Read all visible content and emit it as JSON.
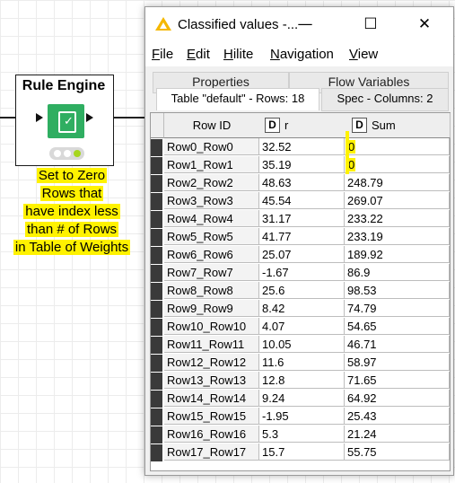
{
  "node": {
    "title": "Rule Engine",
    "label_lines": [
      "Set to Zero",
      "Rows that",
      "have index less",
      "than # of Rows",
      "in Table of Weights"
    ],
    "status_lights": [
      "#ffffff",
      "#ffffff",
      "#a6d61e"
    ]
  },
  "window": {
    "title": "Classified values -...",
    "controls": {
      "minimize": "—",
      "maximize": "☐",
      "close": "✕"
    }
  },
  "menu": [
    {
      "label": "File",
      "key": "F",
      "rest": "ile"
    },
    {
      "label": "Edit",
      "key": "E",
      "rest": "dit"
    },
    {
      "label": "Hilite",
      "key": "H",
      "rest": "ilite"
    },
    {
      "label": "Navigation",
      "key": "N",
      "rest": "avigation"
    },
    {
      "label": "View",
      "key": "V",
      "rest": "iew"
    }
  ],
  "tabs": {
    "back": [
      "Properties",
      "Flow Variables"
    ],
    "front": [
      "Table \"default\" - Rows: 18",
      "Spec - Columns: 2"
    ]
  },
  "table": {
    "columns": [
      {
        "name": "Row ID",
        "type": ""
      },
      {
        "name": "r",
        "type": "D"
      },
      {
        "name": "Sum",
        "type": "D"
      }
    ],
    "rows": [
      [
        "Row0_Row0",
        "32.52",
        "0"
      ],
      [
        "Row1_Row1",
        "35.19",
        "0"
      ],
      [
        "Row2_Row2",
        "48.63",
        "248.79"
      ],
      [
        "Row3_Row3",
        "45.54",
        "269.07"
      ],
      [
        "Row4_Row4",
        "31.17",
        "233.22"
      ],
      [
        "Row5_Row5",
        "41.77",
        "233.19"
      ],
      [
        "Row6_Row6",
        "25.07",
        "189.92"
      ],
      [
        "Row7_Row7",
        "-1.67",
        "86.9"
      ],
      [
        "Row8_Row8",
        "25.6",
        "98.53"
      ],
      [
        "Row9_Row9",
        "8.42",
        "74.79"
      ],
      [
        "Row10_Row10",
        "4.07",
        "54.65"
      ],
      [
        "Row11_Row11",
        "10.05",
        "46.71"
      ],
      [
        "Row12_Row12",
        "11.6",
        "58.97"
      ],
      [
        "Row13_Row13",
        "12.8",
        "71.65"
      ],
      [
        "Row14_Row14",
        "9.24",
        "64.92"
      ],
      [
        "Row15_Row15",
        "-1.95",
        "25.43"
      ],
      [
        "Row16_Row16",
        "5.3",
        "21.24"
      ],
      [
        "Row17_Row17",
        "15.7",
        "55.75"
      ]
    ],
    "highlighted_rows": [
      0,
      1
    ]
  },
  "colors": {
    "highlight": "#fff200",
    "node_green": "#2fae61",
    "app_icon": "#f5b800"
  }
}
